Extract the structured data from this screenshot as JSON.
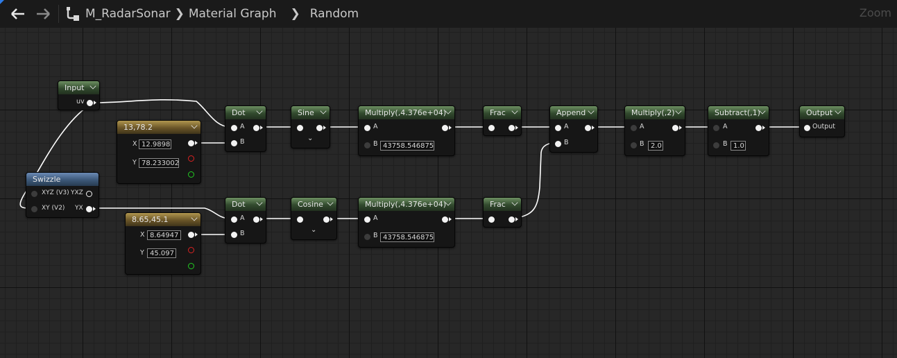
{
  "toolbar": {
    "back_icon": "arrow-left-icon",
    "forward_icon": "arrow-right-icon",
    "graph_icon": "material-graph-icon",
    "breadcrumb": [
      "M_RadarSonar",
      "Material Graph",
      "Random"
    ],
    "zoom_label": "Zoom"
  },
  "nodes": {
    "input": {
      "title": "Input",
      "out": "uv"
    },
    "const1": {
      "title": "13,78.2",
      "x_label": "X",
      "x_value": "12.9898",
      "y_label": "Y",
      "y_value": "78.233002"
    },
    "const2": {
      "title": "8.65,45.1",
      "x_label": "X",
      "x_value": "8.64947",
      "y_label": "Y",
      "y_value": "45.097"
    },
    "swizzle": {
      "title": "Swizzle",
      "in1": "XYZ (V3)",
      "out1": "YXZ",
      "in2": "XY (V2)",
      "out2": "YX"
    },
    "dot1": {
      "title": "Dot",
      "a": "A",
      "b": "B"
    },
    "dot2": {
      "title": "Dot",
      "a": "A",
      "b": "B"
    },
    "sine": {
      "title": "Sine"
    },
    "cosine": {
      "title": "Cosine"
    },
    "mult1": {
      "title": "Multiply(,4.376e+04)",
      "a": "A",
      "b": "B",
      "b_value": "43758.546875"
    },
    "mult2": {
      "title": "Multiply(,4.376e+04)",
      "a": "A",
      "b": "B",
      "b_value": "43758.546875"
    },
    "frac1": {
      "title": "Frac"
    },
    "frac2": {
      "title": "Frac"
    },
    "append": {
      "title": "Append",
      "a": "A",
      "b": "B"
    },
    "mult3": {
      "title": "Multiply(,2)",
      "a": "A",
      "b": "B",
      "b_value": "2.0"
    },
    "subtract": {
      "title": "Subtract(,1)",
      "a": "A",
      "b": "B",
      "b_value": "1.0"
    },
    "output": {
      "title": "Output",
      "in": "Output"
    }
  },
  "colors": {
    "background": "#272727",
    "function_header": "#324a2e",
    "constant_header": "#6a5528",
    "swizzle_header": "#3c5878",
    "wire": "#ffffff",
    "accent": "#2e7ce8"
  }
}
